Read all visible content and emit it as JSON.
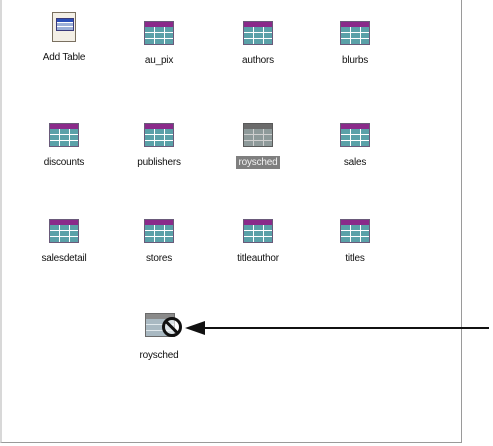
{
  "items": [
    {
      "label": "Add Table",
      "icon": "add-table-icon"
    },
    {
      "label": "au_pix",
      "icon": "table-icon"
    },
    {
      "label": "authors",
      "icon": "table-icon"
    },
    {
      "label": "blurbs",
      "icon": "table-icon"
    },
    {
      "label": "discounts",
      "icon": "table-icon"
    },
    {
      "label": "publishers",
      "icon": "table-icon"
    },
    {
      "label": "roysched",
      "icon": "table-icon",
      "selected": true
    },
    {
      "label": "sales",
      "icon": "table-icon"
    },
    {
      "label": "salesdetail",
      "icon": "table-icon"
    },
    {
      "label": "stores",
      "icon": "table-icon"
    },
    {
      "label": "titleauthor",
      "icon": "table-icon"
    },
    {
      "label": "titles",
      "icon": "table-icon"
    }
  ],
  "denied_item": {
    "label": "roysched",
    "icon": "no-access-table-icon"
  },
  "colors": {
    "selection_bg": "#7f7f7f",
    "table_header": "#8a2a8a",
    "table_rows": "#5aa1a8"
  }
}
